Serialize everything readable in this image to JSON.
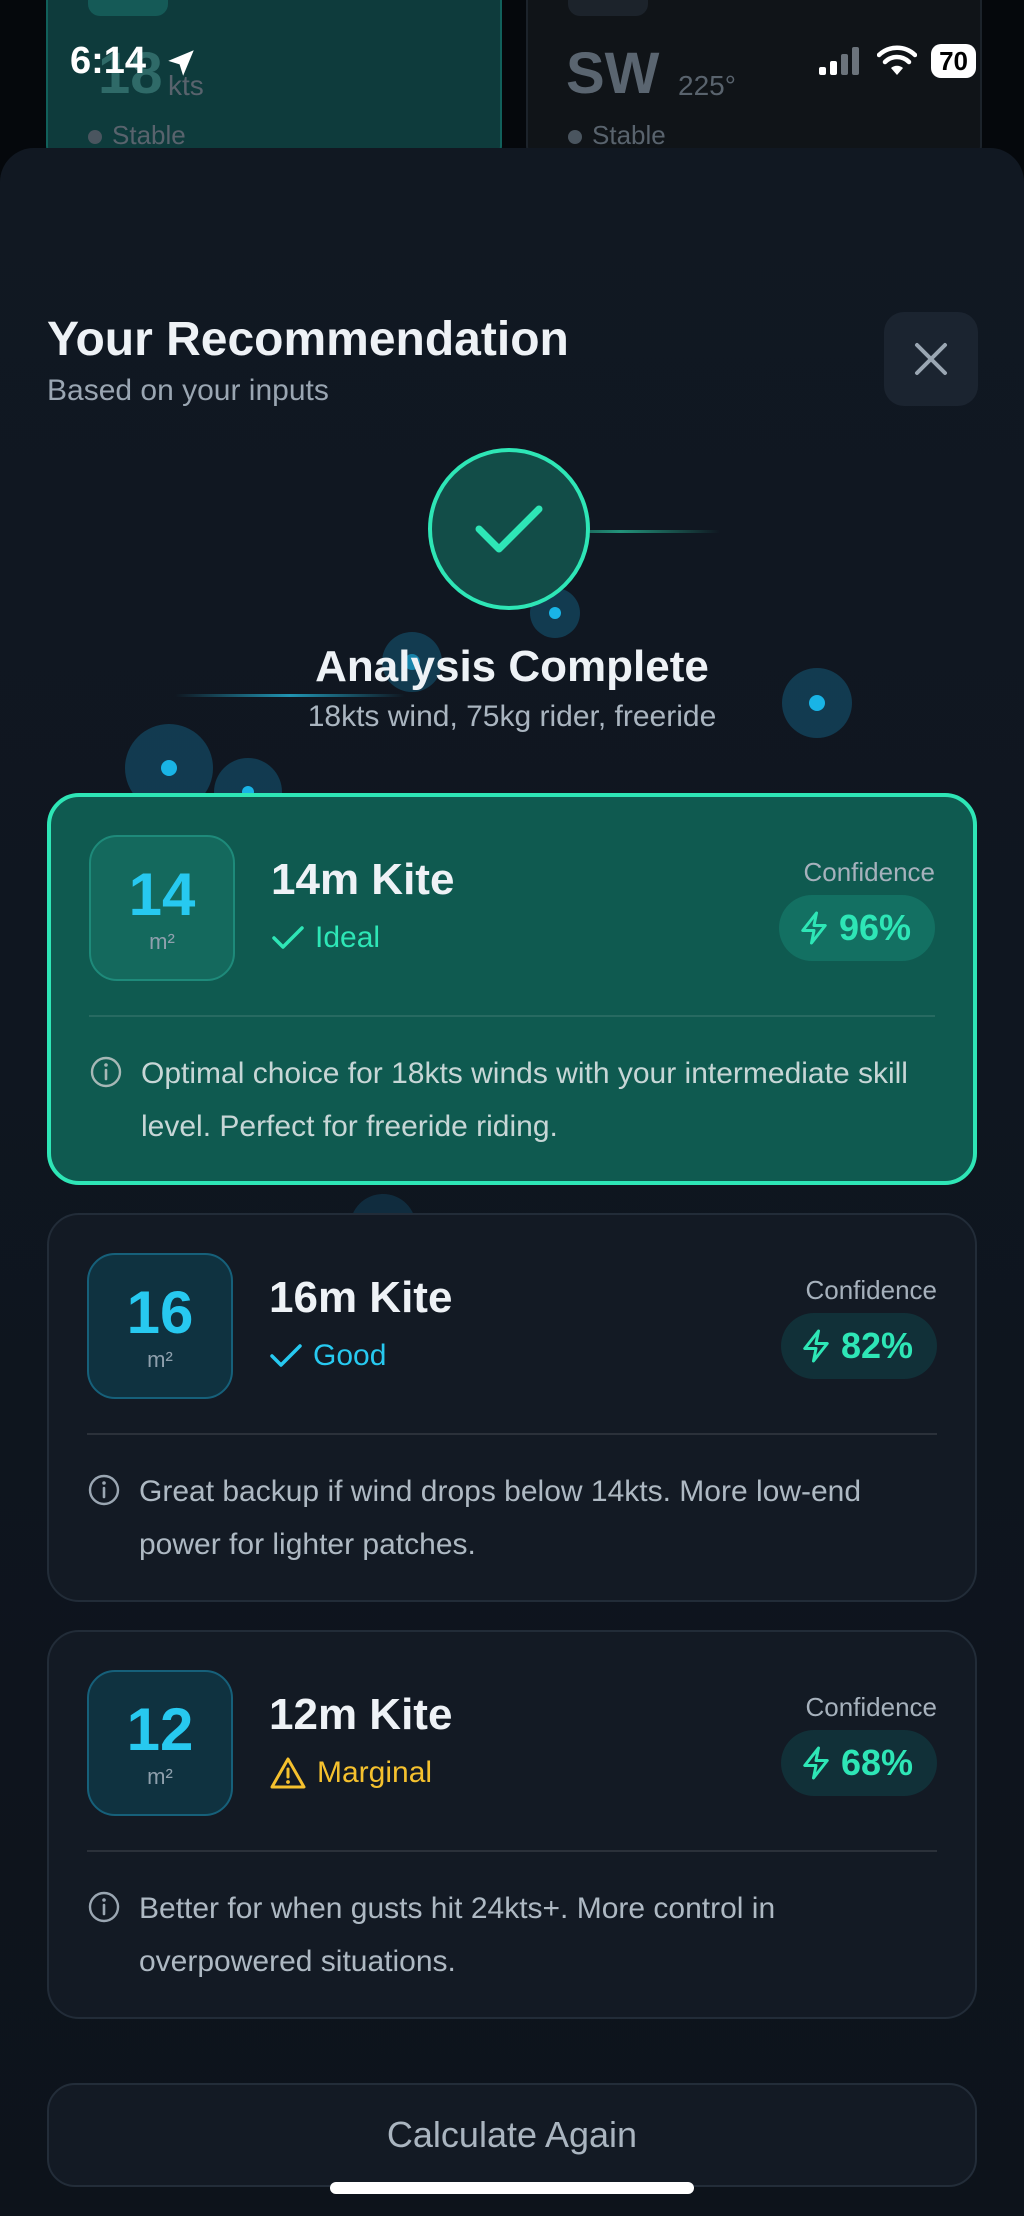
{
  "background_cards": [
    {
      "big": "18",
      "unit": "kts",
      "status": "Stable"
    },
    {
      "big": "SW",
      "unit": "225°",
      "status": "Stable"
    }
  ],
  "status_bar": {
    "time": "6:14",
    "battery": "70",
    "icons": [
      "location-arrow-icon",
      "signal-icon",
      "wifi-icon",
      "battery-icon"
    ]
  },
  "header": {
    "title": "Your Recommendation",
    "subtitle": "Based on your inputs"
  },
  "analysis": {
    "title": "Analysis Complete",
    "summary": "18kts wind, 75kg rider, freeride"
  },
  "recommendations": [
    {
      "size": "14",
      "unit": "m²",
      "name": "14m Kite",
      "rating": "Ideal",
      "rating_color": "#2ee6b6",
      "confidence_label": "Confidence",
      "confidence": "96%",
      "note": "Optimal choice for 18kts winds with your intermediate skill level. Perfect for freeride riding."
    },
    {
      "size": "16",
      "unit": "m²",
      "name": "16m Kite",
      "rating": "Good",
      "rating_color": "#27c9f0",
      "confidence_label": "Confidence",
      "confidence": "82%",
      "note": "Great backup if wind drops below 14kts. More low-end power for lighter patches."
    },
    {
      "size": "12",
      "unit": "m²",
      "name": "12m Kite",
      "rating": "Marginal",
      "rating_color": "#f5c12e",
      "confidence_label": "Confidence",
      "confidence": "68%",
      "note": "Better for when gusts hit 24kts+. More control in overpowered situations."
    }
  ],
  "actions": {
    "calculate_again": "Calculate Again"
  },
  "colors": {
    "accent": "#2ee6b6",
    "info": "#27c9f0",
    "warning": "#f5c12e",
    "background": "#0f1620"
  }
}
